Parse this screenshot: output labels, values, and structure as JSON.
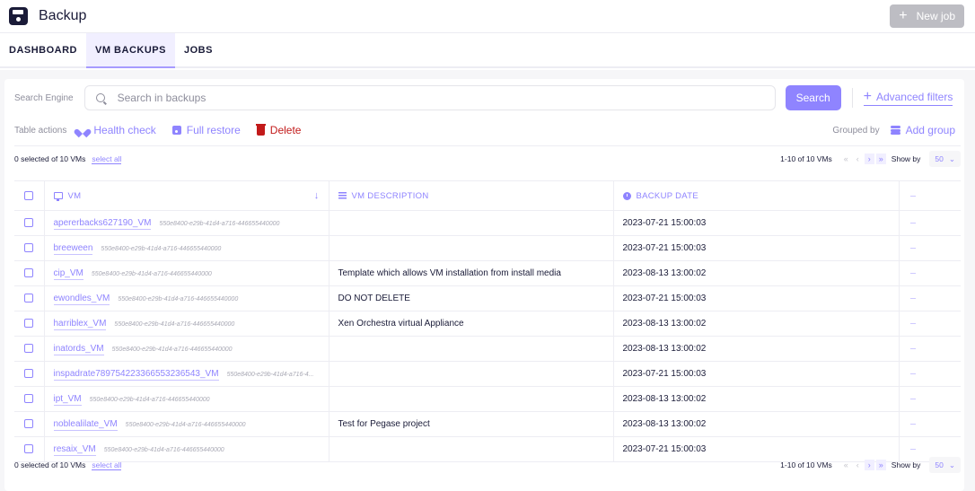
{
  "header": {
    "title": "Backup",
    "new_job_label": "New job"
  },
  "tabs": [
    {
      "label": "DASHBOARD",
      "active": false
    },
    {
      "label": "VM BACKUPS",
      "active": true
    },
    {
      "label": "JOBS",
      "active": false
    }
  ],
  "search": {
    "label": "Search Engine",
    "placeholder": "Search in backups",
    "button_label": "Search",
    "advanced_filters_label": "Advanced filters"
  },
  "table_actions": {
    "label": "Table actions",
    "health_check": "Health check",
    "full_restore": "Full restore",
    "delete": "Delete",
    "grouped_by_label": "Grouped by",
    "add_group": "Add group"
  },
  "pagination": {
    "selected_text": "0 selected of 10 VMs",
    "select_all": "select all",
    "range_text": "1-10 of 10 VMs",
    "first": "«",
    "prev": "‹",
    "next": "›",
    "last": "»",
    "show_by_label": "Show by",
    "page_size": "50"
  },
  "table": {
    "columns": {
      "vm": "VM",
      "description": "VM DESCRIPTION",
      "backup_date": "BACKUP DATE",
      "more": "···"
    },
    "rows": [
      {
        "name": "apererbacks627190_VM",
        "uuid": "550e8400-e29b-41d4-a716-446655440000",
        "description": "",
        "date": "2023-07-21 15:00:03"
      },
      {
        "name": "breeween",
        "uuid": "550e8400-e29b-41d4-a716-446655440000",
        "description": "",
        "date": "2023-07-21 15:00:03"
      },
      {
        "name": "cip_VM",
        "uuid": "550e8400-e29b-41d4-a716-446655440000",
        "description": "Template which allows VM installation from install media",
        "date": "2023-08-13 13:00:02"
      },
      {
        "name": "ewondles_VM",
        "uuid": "550e8400-e29b-41d4-a716-446655440000",
        "description": "DO NOT DELETE",
        "date": "2023-07-21 15:00:03"
      },
      {
        "name": "harriblex_VM",
        "uuid": "550e8400-e29b-41d4-a716-446655440000",
        "description": "Xen Orchestra virtual Appliance",
        "date": "2023-08-13 13:00:02"
      },
      {
        "name": "inatords_VM",
        "uuid": "550e8400-e29b-41d4-a716-446655440000",
        "description": "",
        "date": "2023-08-13 13:00:02"
      },
      {
        "name": "inspadrate789754223366553236543_VM",
        "uuid": "550e8400-e29b-41d4-a716-4...",
        "description": "",
        "date": "2023-07-21 15:00:03"
      },
      {
        "name": "ipt_VM",
        "uuid": "550e8400-e29b-41d4-a716-446655440000",
        "description": "",
        "date": "2023-08-13 13:00:02"
      },
      {
        "name": "noblealilate_VM",
        "uuid": "550e8400-e29b-41d4-a716-446655440000",
        "description": "Test for Pegase project",
        "date": "2023-08-13 13:00:02"
      },
      {
        "name": "resaix_VM",
        "uuid": "550e8400-e29b-41d4-a716-446655440000",
        "description": "",
        "date": "2023-07-21 15:00:03"
      }
    ]
  },
  "colors": {
    "accent": "#8f84ff",
    "danger": "#c21a1a",
    "text": "#1a1b38",
    "muted": "#8e8e9c"
  }
}
